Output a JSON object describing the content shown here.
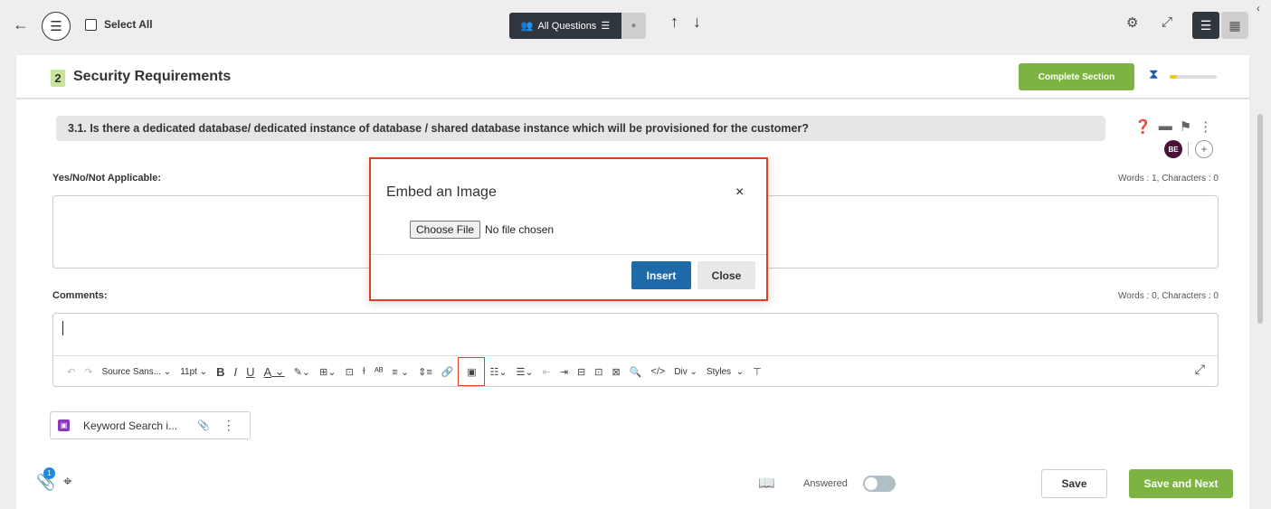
{
  "topbar": {
    "back_icon": "arrow-left-icon",
    "menu_icon": "hamburger-icon",
    "select_all_label": "Select All",
    "all_questions_label": "All Questions",
    "up_icon": "arrow-up-icon",
    "down_icon": "arrow-down-icon",
    "settings_icon": "gear-icon",
    "expand_icon": "expand-icon",
    "list_view_icon": "list-view-icon",
    "grid_view_icon": "grid-view-icon"
  },
  "section": {
    "number": "2",
    "title": "Security Requirements",
    "complete_label": "Complete Section",
    "progress_fraction": 0.15,
    "progress_color": "#f5c518"
  },
  "question": {
    "text": "3.1. Is there a dedicated database/ dedicated instance of database / shared database instance which will be provisioned for the customer?",
    "avatar_initials": "BE",
    "add_avatar": "+"
  },
  "answer": {
    "label": "Yes/No/Not Applicable:",
    "counter": "Words : 1, Characters : 0"
  },
  "comments": {
    "label": "Comments:",
    "counter": "Words : 0, Characters : 0"
  },
  "toolbar": {
    "font_family": "Source Sans...",
    "font_size": "11pt",
    "bold": "B",
    "italic": "I",
    "underline": "U",
    "font_color": "A",
    "div_label": "Div",
    "styles_label": "Styles"
  },
  "attachment": {
    "name": "Keyword Search i..."
  },
  "footer": {
    "attachment_count": "1",
    "answered_label": "Answered",
    "answered_on": false,
    "save_label": "Save",
    "save_next_label": "Save and Next"
  },
  "modal": {
    "title": "Embed an Image",
    "close_icon": "×",
    "choose_file_label": "Choose File",
    "no_file_label": "No file chosen",
    "insert_label": "Insert",
    "close_label": "Close"
  },
  "colors": {
    "accent_green": "#7cb342",
    "primary_blue": "#1e6aa8",
    "highlight_red": "#e0401c"
  }
}
